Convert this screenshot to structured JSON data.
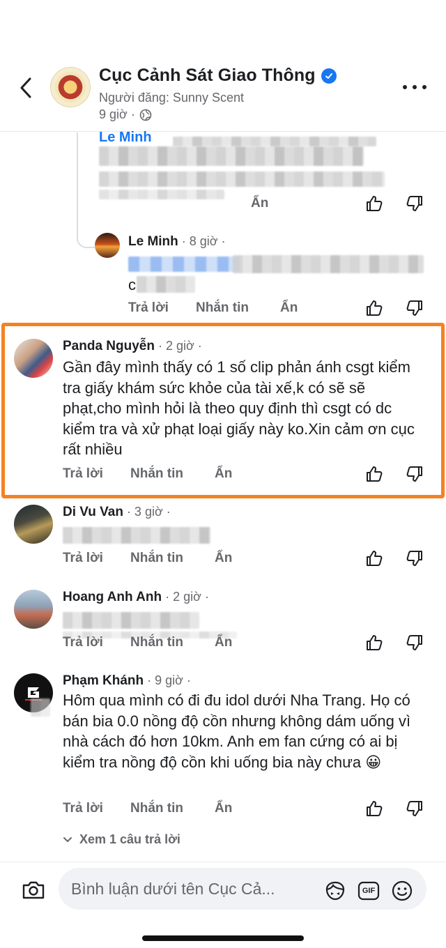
{
  "header": {
    "page_name": "Cục Cảnh Sát Giao Thông",
    "poster": "Người đăng: Sunny Scent",
    "post_time": "9 giờ ·"
  },
  "actions": {
    "reply": "Trả lời",
    "message": "Nhắn tin",
    "hide": "Ẩn"
  },
  "partial_reply": {
    "name_link": "Le Minh",
    "text": "up len youtube de che do không c"
  },
  "comments": [
    {
      "name": "Le Minh",
      "meta": " · 8 giờ ·",
      "text_start": "c"
    },
    {
      "name": "Panda Nguyễn",
      "meta": " · 2 giờ ·",
      "text": "Gần đây mình thấy có 1 số clip phản ánh csgt kiểm tra giấy khám sức khỏe của tài xế,k có sẽ sẽ phạt,cho mình hỏi là theo quy định thì csgt có dc kiểm tra và xử phạt loại giấy này ko.Xin cảm ơn cục rất nhiều"
    },
    {
      "name": "Di Vu Van",
      "meta": " · 3 giờ ·"
    },
    {
      "name": "Hoang Anh Anh",
      "meta": " · 2 giờ ·"
    },
    {
      "name": "Phạm Khánh",
      "meta": " · 9 giờ ·",
      "text": "Hôm qua mình có đi đu idol dưới Nha Trang. Họ có bán bia 0.0 nồng độ cồn nhưng không dám uống vì nhà cách đó hơn 10km. Anh em fan cứng có ai bị kiểm tra nồng độ cồn khi uống bia này chưa",
      "emoji": "😀"
    }
  ],
  "view_replies": "Xem 1 câu trả lời",
  "composer": {
    "placeholder": "Bình luận dưới tên Cục Cả...",
    "gif_label": "GIF"
  },
  "colors": {
    "highlight": "#f58220",
    "link": "#1877f2",
    "secondary_text": "#65676b"
  }
}
